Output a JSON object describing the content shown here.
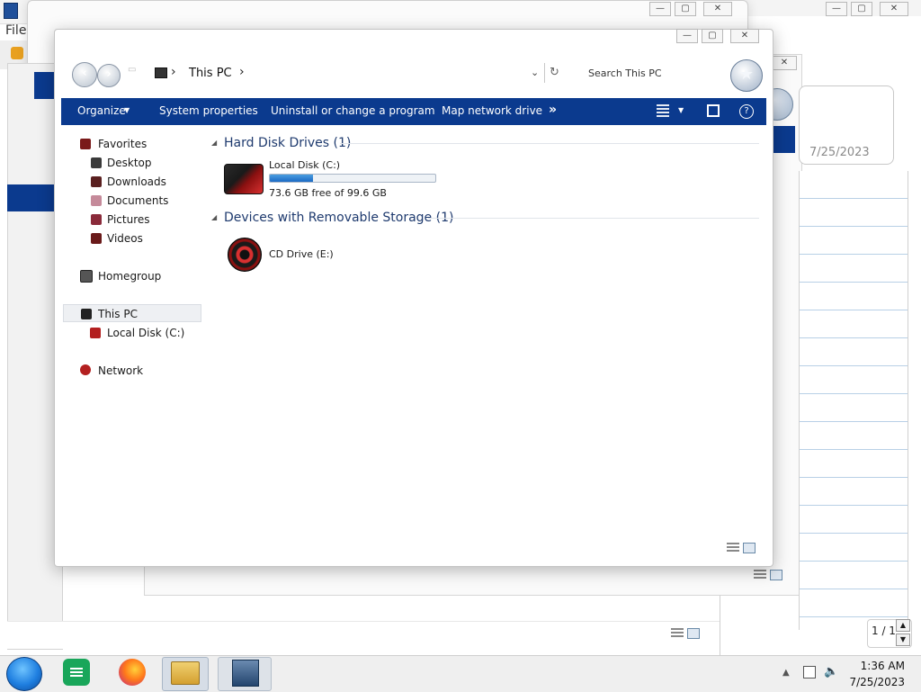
{
  "background": {
    "file_menu": "File",
    "back_window_date": "7/25/2023",
    "pager": "1 / 1"
  },
  "window": {
    "controls": {
      "minimize": "—",
      "maximize": "▢",
      "close": "✕"
    }
  },
  "address_bar": {
    "location": "This PC",
    "search_placeholder": "Search This PC"
  },
  "command_bar": {
    "organize": "Organize",
    "system_properties": "System properties",
    "uninstall": "Uninstall or change a program",
    "map_drive": "Map network drive",
    "more": "»"
  },
  "nav_pane": {
    "favorites": "Favorites",
    "desktop": "Desktop",
    "downloads": "Downloads",
    "documents": "Documents",
    "pictures": "Pictures",
    "videos": "Videos",
    "homegroup": "Homegroup",
    "this_pc": "This PC",
    "local_disk": "Local Disk (C:)",
    "network": "Network"
  },
  "content": {
    "hdd_group": "Hard Disk Drives (1)",
    "local_disk_name": "Local Disk (C:)",
    "local_disk_space": "73.6 GB free of 99.6 GB",
    "local_disk_used_fraction": 0.261,
    "removable_group": "Devices with Removable Storage (1)",
    "cd_drive": "CD Drive (E:)"
  },
  "taskbar": {
    "time": "1:36 AM",
    "date": "7/25/2023"
  },
  "colors": {
    "command_bar": "#0b3a8e",
    "group_title": "#1e3a6e",
    "progress_fill": "#1c6ac4"
  }
}
